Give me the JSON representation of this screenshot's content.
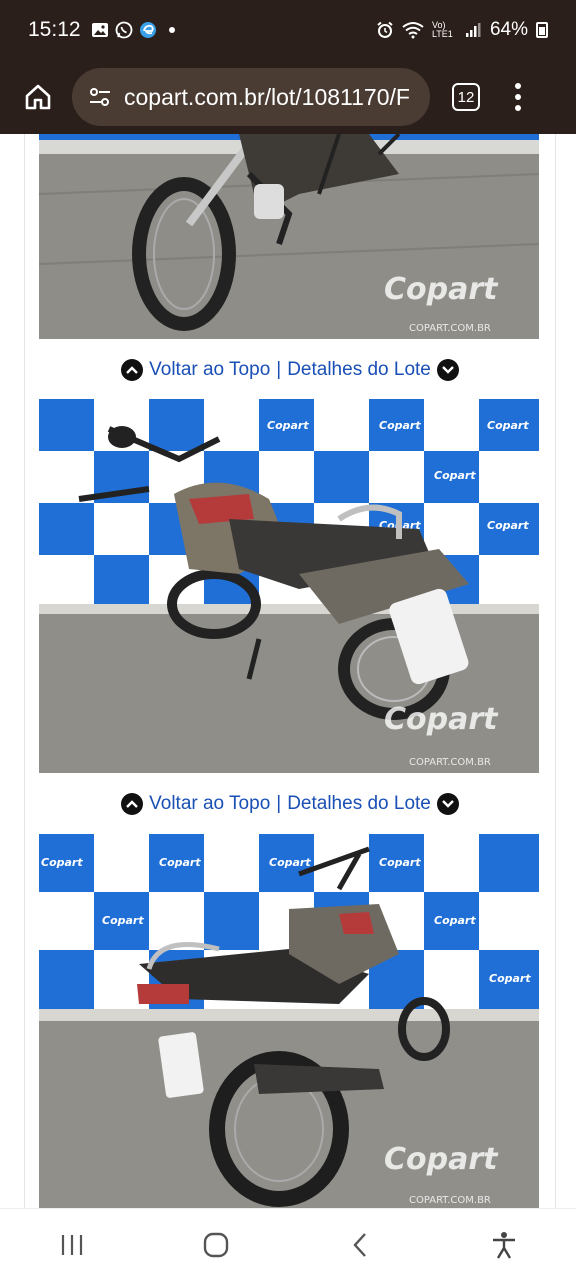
{
  "status_bar": {
    "time": "15:12",
    "left_icons": [
      "gallery-icon",
      "whatsapp-icon",
      "edge-icon",
      "dot-icon"
    ],
    "right_icons": [
      "alarm-icon",
      "wifi-icon",
      "volte-icon",
      "signal-icon"
    ],
    "volte_label": "Vo) LTE1",
    "battery": "64%"
  },
  "browser": {
    "url": "copart.com.br/lot/1081170/F",
    "tab_count": "12"
  },
  "page": {
    "nav_rows": [
      {
        "back_to_top": "Voltar ao Topo",
        "separator": "|",
        "lot_details": "Detalhes do Lote"
      },
      {
        "back_to_top": "Voltar ao Topo",
        "separator": "|",
        "lot_details": "Detalhes do Lote"
      }
    ],
    "photos": [
      {
        "watermark": "Copart",
        "watermark_sub": "COPART.COM.BR"
      },
      {
        "watermark": "Copart",
        "watermark_sub": "COPART.COM.BR"
      },
      {
        "watermark": "Copart",
        "watermark_sub": "COPART.COM.BR"
      }
    ],
    "backdrop_brand": "Copart"
  },
  "colors": {
    "status_bg": "#2a1f1a",
    "url_pill": "#4a3c33",
    "link": "#1a4fb5",
    "banner_blue": "#1f6fd6"
  }
}
